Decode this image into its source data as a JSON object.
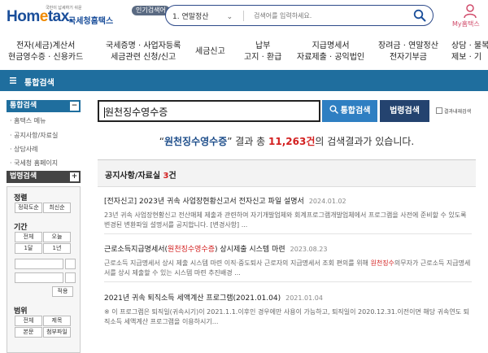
{
  "header": {
    "logo_brand_a": "Hom",
    "logo_brand_dot": "e",
    "logo_brand_b": "tax.",
    "logo_tagline": "국민이 납세하기 쉬운",
    "logo_kr": "국세청홈택스",
    "popular_badge": "인기검색어",
    "popular_selected": "1.  연말정산",
    "search_placeholder": "검색어를 입력하세요.",
    "myhome_label": "My홈택스",
    "accent": "#1a4e9a"
  },
  "nav": [
    {
      "line1": "전자(세금)계산서",
      "line2": "현금영수증 · 신용카드"
    },
    {
      "line1": "국세증명 · 사업자등록",
      "line2": "세금관련 신청/신고"
    },
    {
      "line1": "세금신고",
      "line2": ""
    },
    {
      "line1": "납부",
      "line2": "고지 · 환급"
    },
    {
      "line1": "지급명세서",
      "line2": "자료제출 · 공익법인"
    },
    {
      "line1": "장려금 · 연말정산",
      "line2": "전자기부금"
    },
    {
      "line1": "상담 · 불복",
      "line2": "제보 · 기"
    }
  ],
  "bluebar_title": "통합검색",
  "sidebar": {
    "section1_title": "통합검색",
    "section1_toggle": "−",
    "links": [
      "· 홈택스 메뉴",
      "· 공지사항/자료실",
      "· 상담사례",
      "· 국세청 홈페이지"
    ],
    "section2_title": "법령검색",
    "section2_toggle": "+",
    "sort_title": "정렬",
    "sort_options": [
      "정확도순",
      "최신순"
    ],
    "period_title": "기간",
    "period_options": [
      "전체",
      "오늘",
      "1달",
      "1년"
    ],
    "apply_label": "적용",
    "scope_title": "범위",
    "scope_options": [
      "전체",
      "제목",
      "본문",
      "첨부파일"
    ]
  },
  "main": {
    "query": "원천징수영수증",
    "btn_integrated": "통합검색",
    "btn_law": "법령검색",
    "within_label": "결과내재검색",
    "summary_pre": "“",
    "summary_kw": "원천징수영수증",
    "summary_mid": "” 결과 총 ",
    "summary_count": "11,263",
    "summary_count_suffix": "건",
    "summary_post": "의 검색결과가 있습니다.",
    "section_title": "공지사항/자료실",
    "section_count": "3",
    "section_count_suffix": "건",
    "results": [
      {
        "title_a": "[전자신고] 2023년 귀속 사업장현황신고서 전자신고 파일 설명서",
        "title_hl": "",
        "title_b": "",
        "date": "2024.01.02",
        "desc_a": "23년 귀속 사업장현황신고 전산매체 제출과 관련하여 자기개발업체와 회계프로그램개발업체에서 프로그램을 사전에 준비할 수 있도록 변경된 변환파일 설명서를 공지합니다. [변경사항] ...",
        "desc_hl": "",
        "desc_b": ""
      },
      {
        "title_a": "근로소득지급명세서(",
        "title_hl": "원천징수영수증",
        "title_b": ") 상시제출 시스템 마련",
        "date": "2023.08.23",
        "desc_a": "근로소득 지급명세서 상시 제출 시스템 마련 이직·중도퇴사 근로자의 지급명세서 조회 편의를 위해 ",
        "desc_hl": "원천징수",
        "desc_b": "의무자가 근로소득 지급명세서를 상시 제출할 수 있는 시스템 마련 추진배경 ..."
      },
      {
        "title_a": "2021년 귀속 퇴직소득 세액계산 프로그램(2021.01.04)",
        "title_hl": "",
        "title_b": "",
        "date": "2021.01.04",
        "desc_a": "※ 이 프로그램은 퇴직일(귀속시기)이 2021.1.1.이후인 경우에만 사용이 가능하고, 퇴직일이 2020.12.31.이전이면 해당 귀속연도 퇴직소득 세액계산 프로그램을 이용하시기...",
        "desc_hl": "",
        "desc_b": ""
      }
    ]
  }
}
